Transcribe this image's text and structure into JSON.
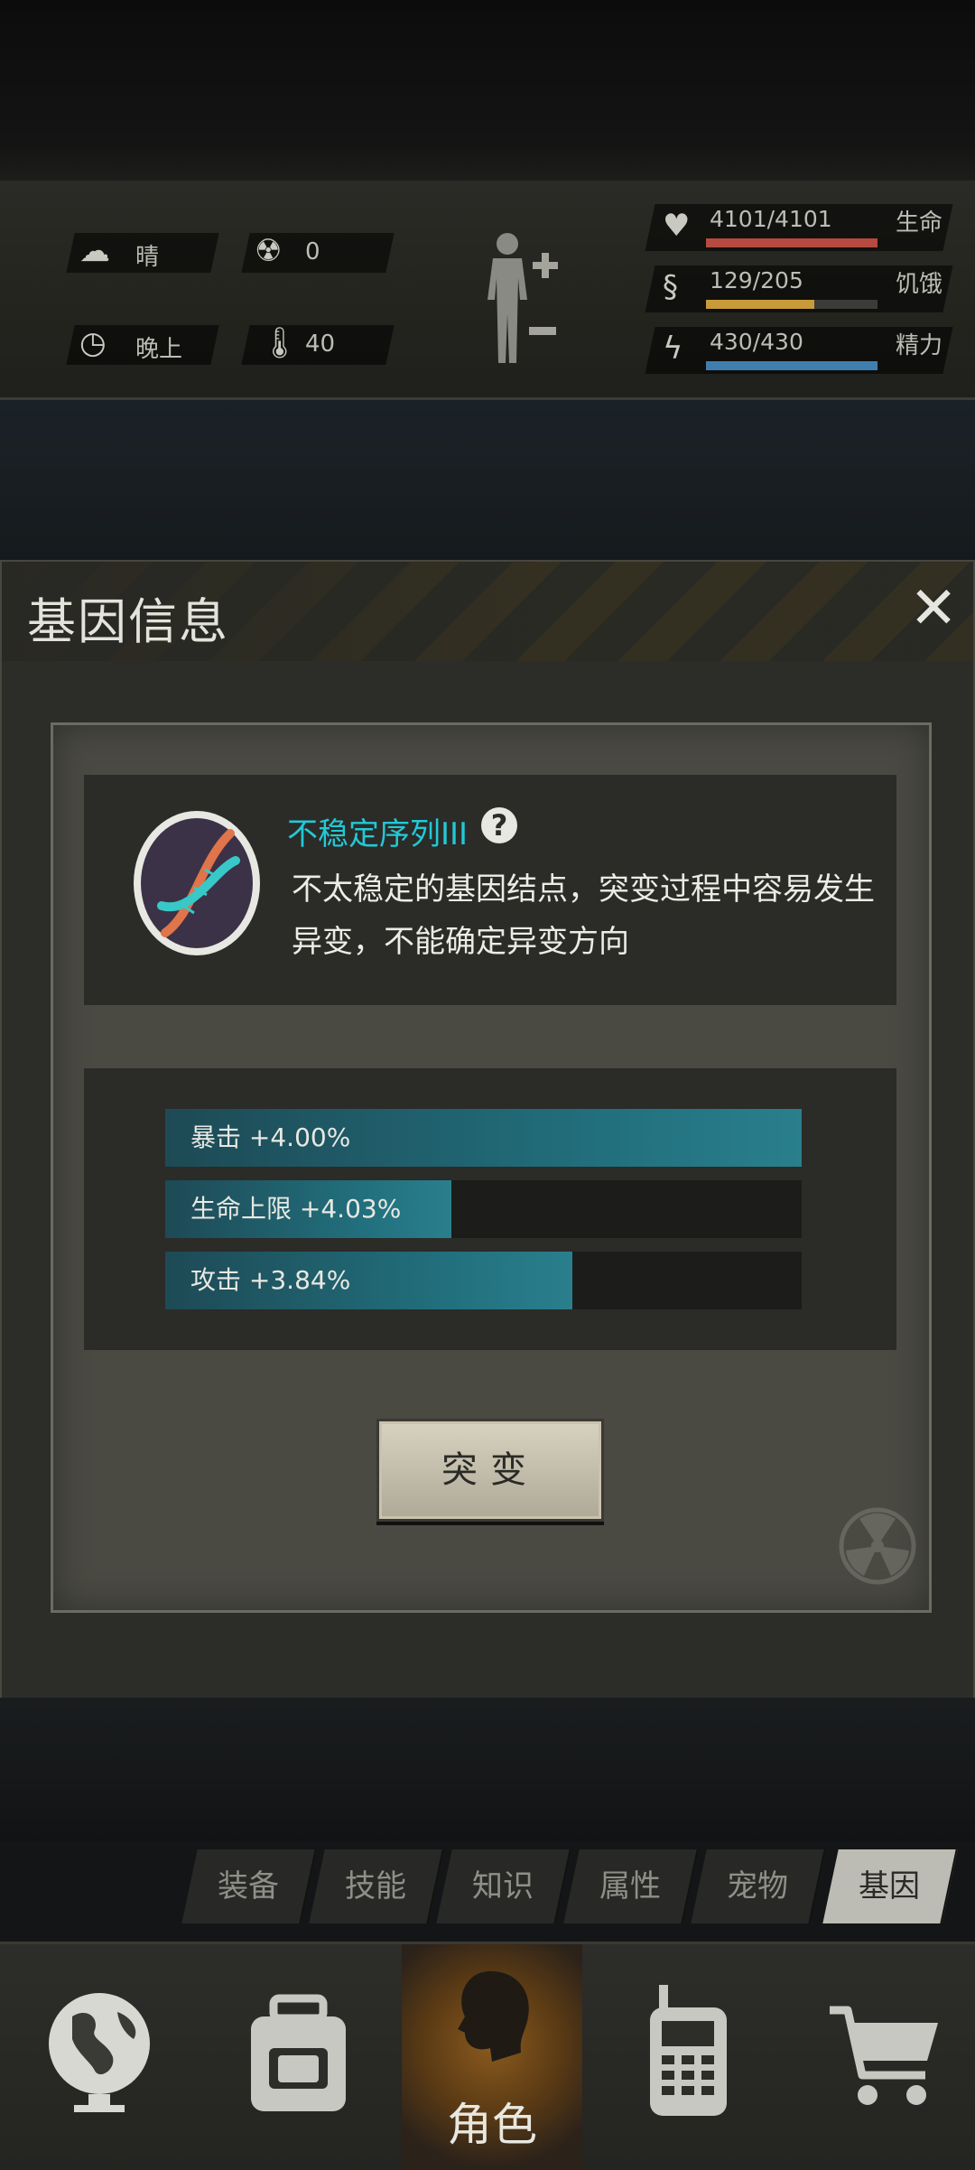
{
  "hud": {
    "weather": "晴",
    "radiation": "0",
    "time_of_day": "晚上",
    "temperature": "40",
    "stats": [
      {
        "value": "4101/4101",
        "label": "生命",
        "fill": 1.0,
        "color": "#b64a40"
      },
      {
        "value": "129/205",
        "label": "饥饿",
        "fill": 0.63,
        "color": "#c99a3a"
      },
      {
        "value": "430/430",
        "label": "精力",
        "fill": 1.0,
        "color": "#3f7fb0"
      }
    ]
  },
  "dialog": {
    "title": "基因信息",
    "gene": {
      "name": "不稳定序列III",
      "help": "?",
      "description": "不太稳定的基因结点，突变过程中容易发生异变，不能确定异变方向"
    },
    "attributes": [
      {
        "label": "暴击 +4.00%",
        "fill": 1.0
      },
      {
        "label": "生命上限 +4.03%",
        "fill": 0.45
      },
      {
        "label": "攻击 +3.84%",
        "fill": 0.64
      }
    ],
    "mutate_button": "突变"
  },
  "tabs": [
    {
      "label": "装备",
      "active": false
    },
    {
      "label": "技能",
      "active": false
    },
    {
      "label": "知识",
      "active": false
    },
    {
      "label": "属性",
      "active": false
    },
    {
      "label": "宠物",
      "active": false
    },
    {
      "label": "基因",
      "active": true
    }
  ],
  "nav": {
    "active_label": "角色",
    "items": [
      "globe-icon",
      "backpack-icon",
      "character-icon",
      "radio-icon",
      "cart-icon"
    ]
  }
}
